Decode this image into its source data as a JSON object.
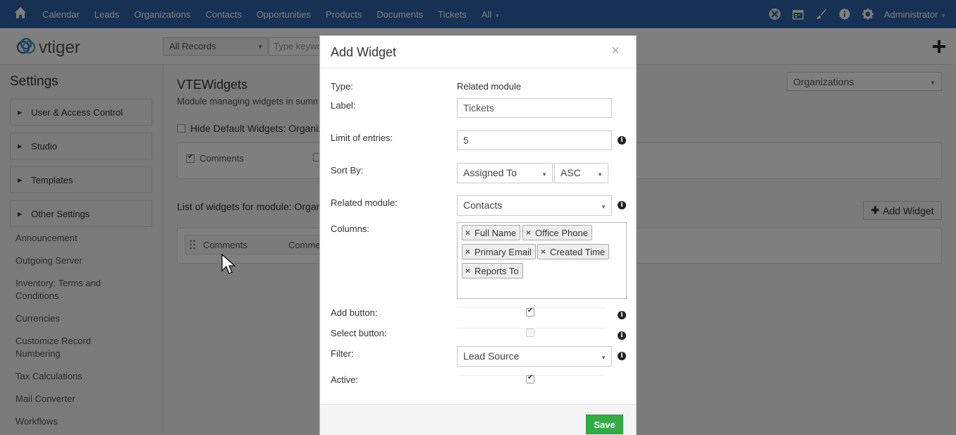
{
  "topnav": {
    "menu": [
      "Calendar",
      "Leads",
      "Organizations",
      "Contacts",
      "Opportunities",
      "Products",
      "Documents",
      "Tickets",
      "All"
    ],
    "user": "Administrator"
  },
  "header": {
    "logo_text": "vtiger",
    "record_select": "All Records",
    "keyword_placeholder": "Type keyword"
  },
  "sidebar": {
    "title": "Settings",
    "sections": [
      "User & Access Control",
      "Studio",
      "Templates",
      "Other Settings"
    ],
    "items": [
      "Announcement",
      "Outgoing Server",
      "Inventory: Terms and Conditions",
      "Currencies",
      "Customize Record Numbering",
      "Tax Calculations",
      "Mail Converter",
      "Workflows"
    ]
  },
  "main": {
    "title": "VTEWidgets",
    "description": "Module managing widgets in summary view",
    "module_select": "Organizations",
    "hide_default": "Hide Default Widgets: Organizations",
    "default_widget": "Comments",
    "list_title": "List of widgets for module: Organizations",
    "add_widget": "Add Widget",
    "row_name": "Comments",
    "row_type": "Comments"
  },
  "modal": {
    "title": "Add Widget",
    "close": "×",
    "type_label": "Type:",
    "type_value": "Related module",
    "label_label": "Label:",
    "label_value": "Tickets",
    "limit_label": "Limit of entries:",
    "limit_value": "5",
    "sort_label": "Sort By:",
    "sort_field": "Assigned To",
    "sort_order": "ASC",
    "related_label": "Related module:",
    "related_value": "Contacts",
    "columns_label": "Columns:",
    "columns": [
      "Full Name",
      "Office Phone",
      "Primary Email",
      "Created Time",
      "Reports To"
    ],
    "add_button_label": "Add button:",
    "add_button_checked": true,
    "select_button_label": "Select button:",
    "select_button_checked": false,
    "filter_label": "Filter:",
    "filter_value": "Lead Source",
    "active_label": "Active:",
    "active_checked": true,
    "save": "Save"
  }
}
